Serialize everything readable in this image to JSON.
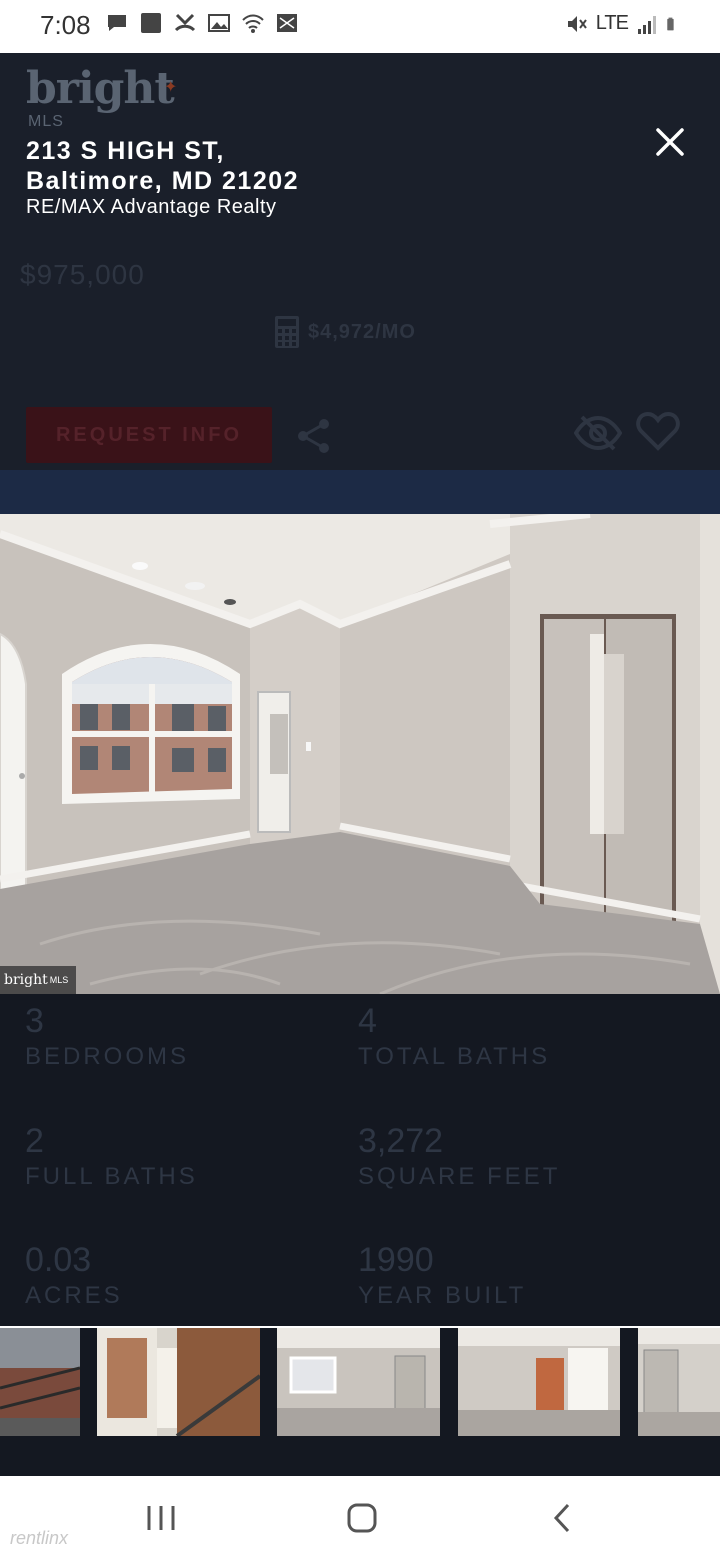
{
  "status_bar": {
    "time": "7:08",
    "network": "LTE"
  },
  "header": {
    "logo": "bright",
    "logo_sub": "MLS",
    "price": "$975,000",
    "monthly_payment": "$4,972/MO",
    "request_info_label": "REQUEST INFO"
  },
  "overlay": {
    "address_line1": "213 S HIGH ST,",
    "address_line2": "Baltimore, MD 21202",
    "broker": "RE/MAX Advantage Realty"
  },
  "photo": {
    "watermark": "bright",
    "watermark_sub": "MLS"
  },
  "stats": [
    {
      "value": "3",
      "label": "BEDROOMS"
    },
    {
      "value": "4",
      "label": "TOTAL BATHS"
    },
    {
      "value": "2",
      "label": "FULL BATHS"
    },
    {
      "value": "3,272",
      "label": "SQUARE FEET"
    },
    {
      "value": "0.03",
      "label": "ACRES"
    },
    {
      "value": "1990",
      "label": "YEAR BUILT"
    }
  ],
  "footer": {
    "brand": "rentlinx"
  },
  "colors": {
    "overlay_bg": "#141821",
    "request_button": "#3a1218",
    "band": "#1c2a45"
  },
  "icons": [
    "chat-icon",
    "square-icon",
    "missed-call-icon",
    "image-icon",
    "wifi-icon",
    "photo-icon",
    "mute-icon",
    "signal-icon",
    "battery-icon",
    "calculator-icon",
    "share-icon",
    "hide-icon",
    "heart-icon",
    "close-icon",
    "recents-icon",
    "home-icon",
    "back-icon"
  ]
}
